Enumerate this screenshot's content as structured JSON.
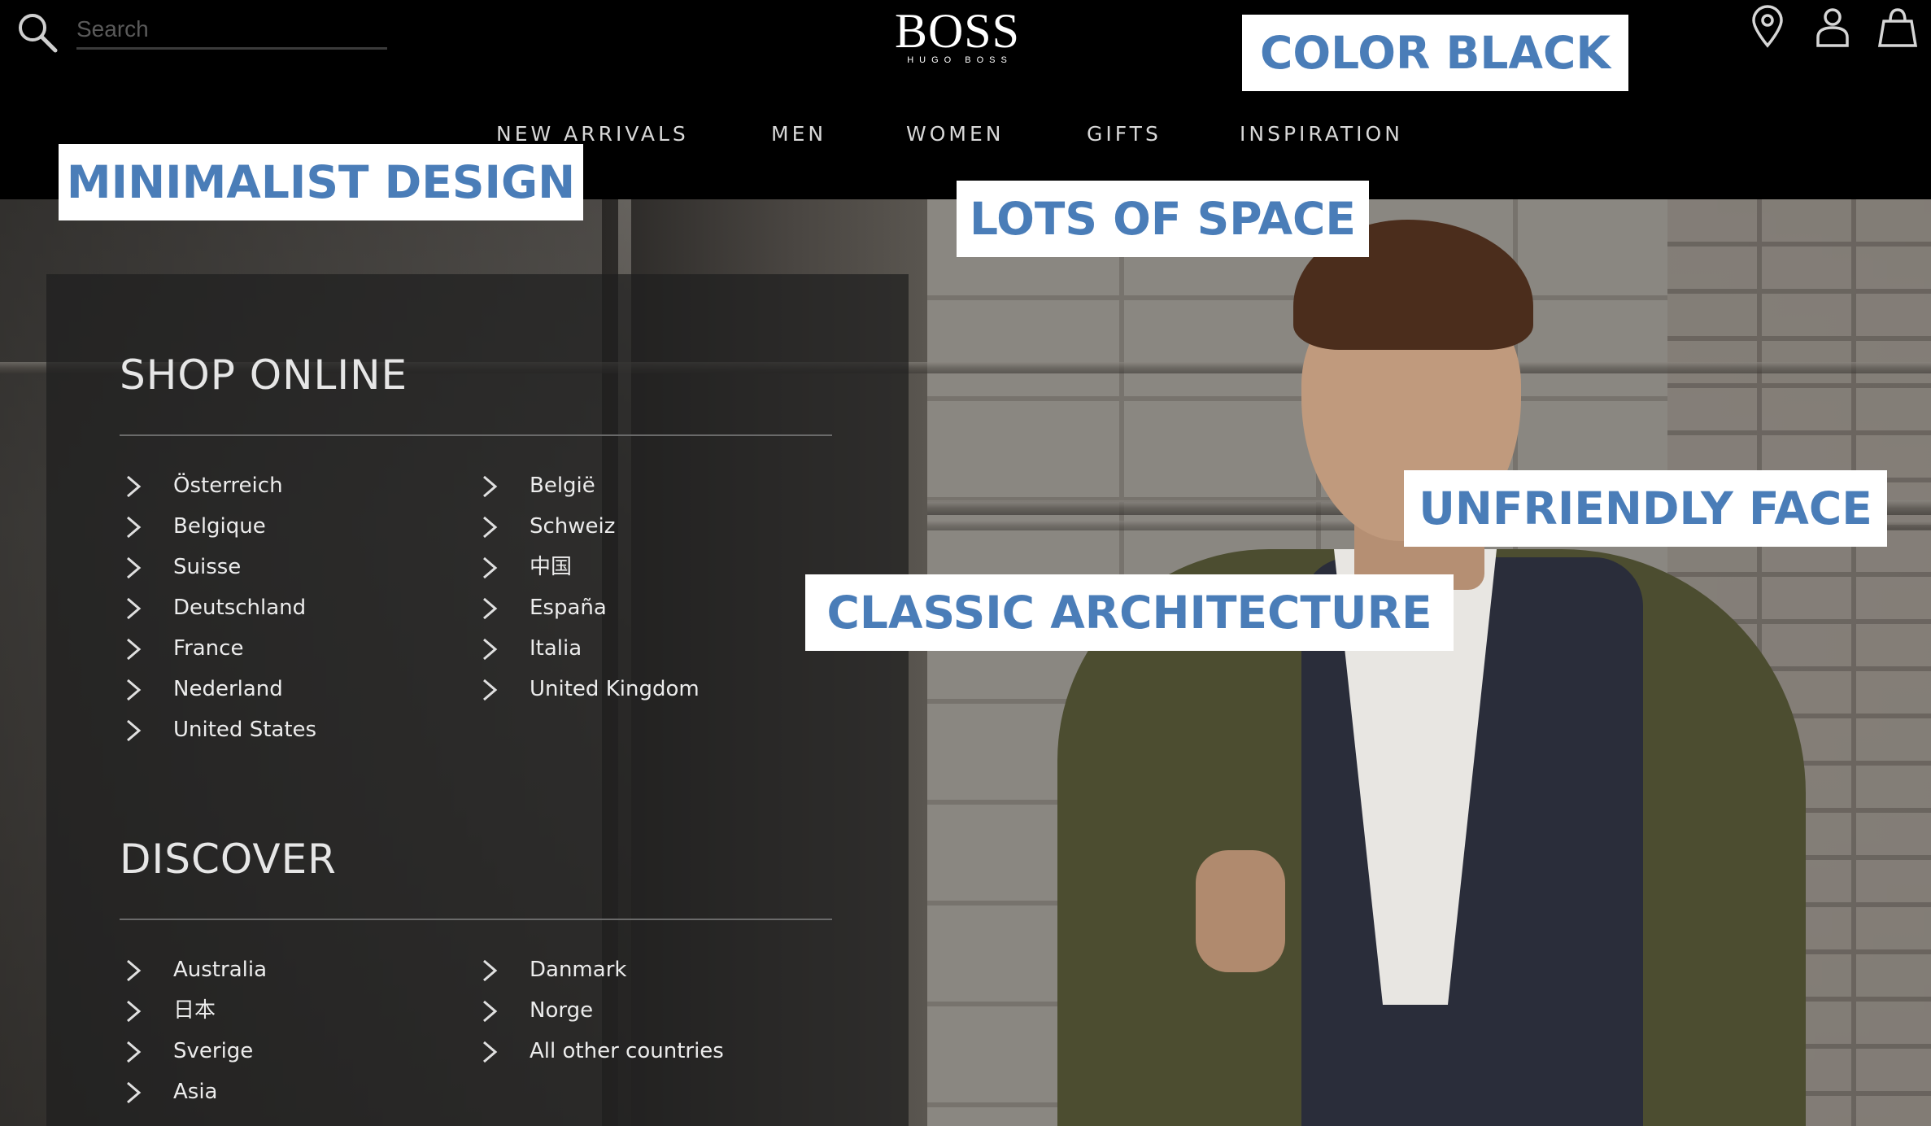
{
  "header": {
    "search": {
      "placeholder": "Search",
      "value": ""
    },
    "logo": {
      "main": "BOSS",
      "sub": "HUGO BOSS"
    },
    "nav": [
      "NEW ARRIVALS",
      "MEN",
      "WOMEN",
      "GIFTS",
      "INSPIRATION"
    ],
    "icons": [
      "search-icon",
      "location-pin-icon",
      "account-icon",
      "shopping-bag-icon"
    ]
  },
  "panel": {
    "shop_online": {
      "title": "SHOP ONLINE",
      "col1": [
        "Österreich",
        "Belgique",
        "Suisse",
        "Deutschland",
        "France",
        "Nederland",
        "United States"
      ],
      "col2": [
        "België",
        "Schweiz",
        "中国",
        "España",
        "Italia",
        "United Kingdom"
      ]
    },
    "discover": {
      "title": "DISCOVER",
      "col1": [
        "Australia",
        "日本",
        "Sverige",
        "Asia"
      ],
      "col2": [
        "Danmark",
        "Norge",
        "All other countries"
      ]
    }
  },
  "annotations": {
    "color_black": "COLOR BLACK",
    "minimalist_design": "MINIMALIST DESIGN",
    "lots_of_space": "LOTS OF SPACE",
    "unfriendly_face": "UNFRIENDLY FACE",
    "classic_architecture": "CLASSIC ARCHITECTURE"
  },
  "colors": {
    "header_bg": "#000000",
    "tag_text": "#4a7db8",
    "tag_bg": "#ffffff"
  }
}
